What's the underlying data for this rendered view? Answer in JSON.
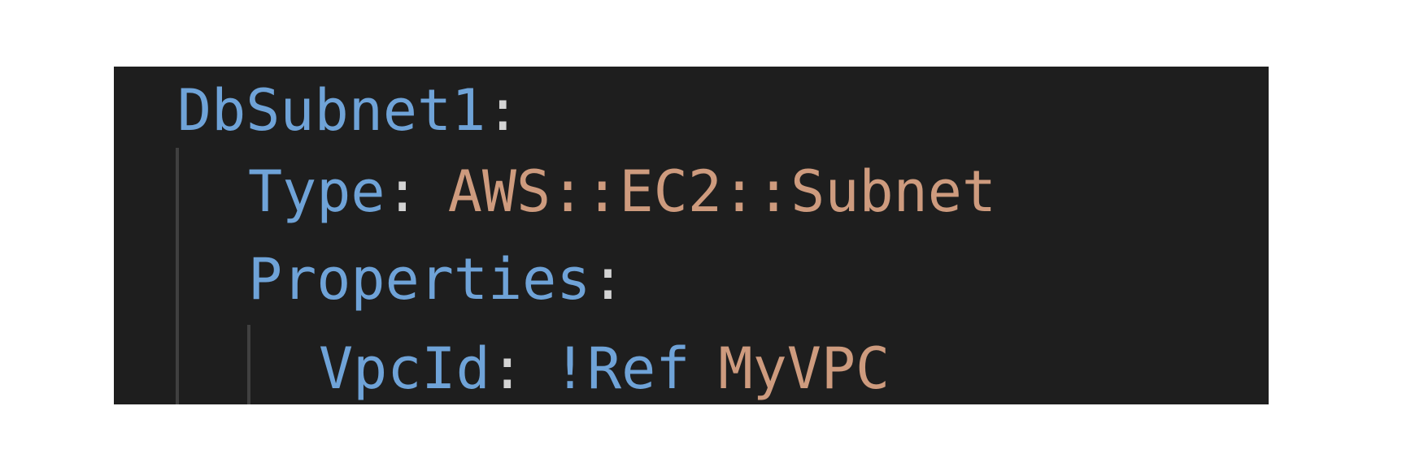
{
  "editor": {
    "lines": [
      {
        "key": "DbSubnet1",
        "sep": ":"
      },
      {
        "key": "Type",
        "sep": ":",
        "value": "AWS::EC2::Subnet"
      },
      {
        "key": "Properties",
        "sep": ":"
      },
      {
        "key": "VpcId",
        "sep": ":",
        "tag": "!Ref",
        "value": "MyVPC"
      }
    ],
    "colors": {
      "background": "#1e1e1e",
      "key": "#6fa3d8",
      "punctuation": "#d4d4d4",
      "string": "#ce9b7e",
      "indent_guide": "#404040"
    }
  }
}
